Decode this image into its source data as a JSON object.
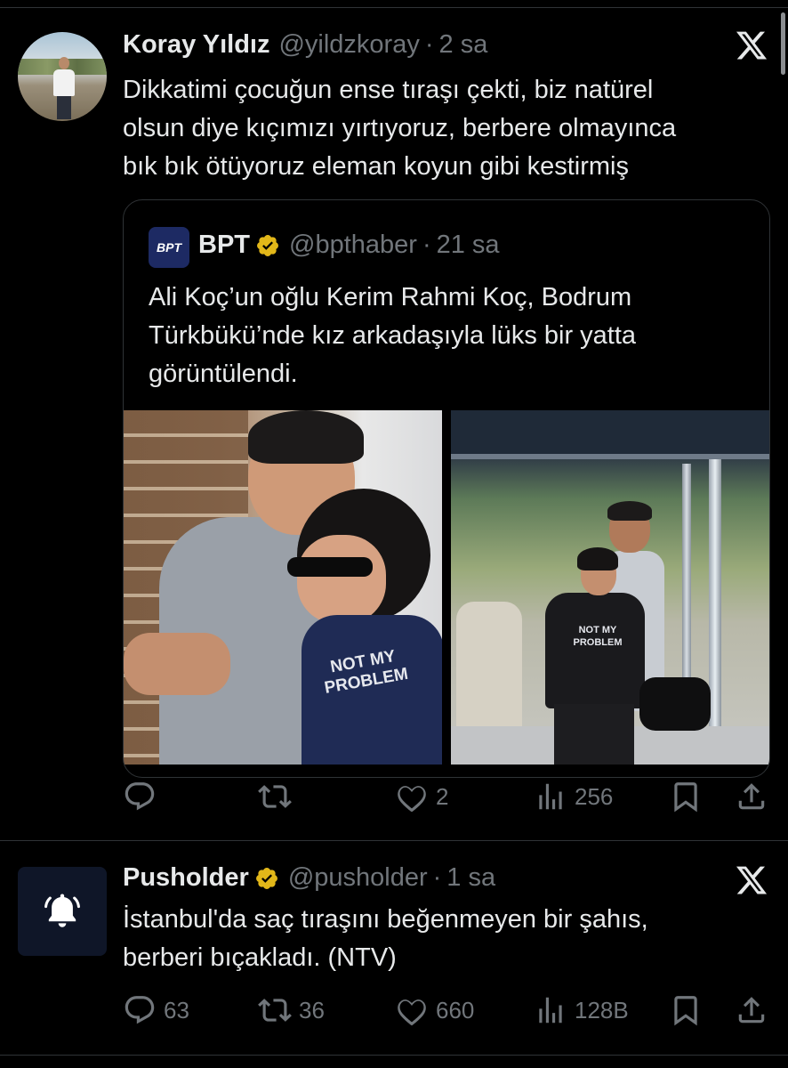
{
  "tweets": [
    {
      "name": "Koray Yıldız",
      "handle": "@yildzkoray",
      "separator": "·",
      "time": "2 sa",
      "text_lines": [
        "Dikkatimi çocuğun ense tıraşı çekti, biz natürel",
        "olsun diye kıçımızı yırtıyoruz, berbere olmayınca",
        "bık bık ötüyoruz eleman koyun gibi kestirmiş"
      ],
      "quote": {
        "avatar_text": "BPT",
        "name": "BPT",
        "handle": "@bpthaber",
        "separator": "·",
        "time": "21 sa",
        "text_lines": [
          "Ali Koç’un oğlu Kerim Rahmi Koç, Bodrum",
          "Türkbükü’nde kız arkadaşıyla lüks bir yatta",
          "görüntülendi."
        ],
        "photo_left_shirt": "NOT MY PROBLEM",
        "photo_right_shirt": "NOT MY PROBLEM"
      },
      "actions": {
        "replies": "",
        "retweets": "",
        "likes": "2",
        "views": "256"
      }
    },
    {
      "name": "Pusholder",
      "handle": "@pusholder",
      "separator": "·",
      "time": "1 sa",
      "text_lines": [
        "İstanbul'da saç tıraşını beğenmeyen bir şahıs,",
        "berberi bıçakladı. (NTV)"
      ],
      "actions": {
        "replies": "63",
        "retweets": "36",
        "likes": "660",
        "views": "128B"
      }
    }
  ],
  "colors": {
    "background": "#000000",
    "text": "#e7e9ea",
    "muted": "#71767b",
    "border": "#2f3336",
    "verified": "#e2b719"
  }
}
